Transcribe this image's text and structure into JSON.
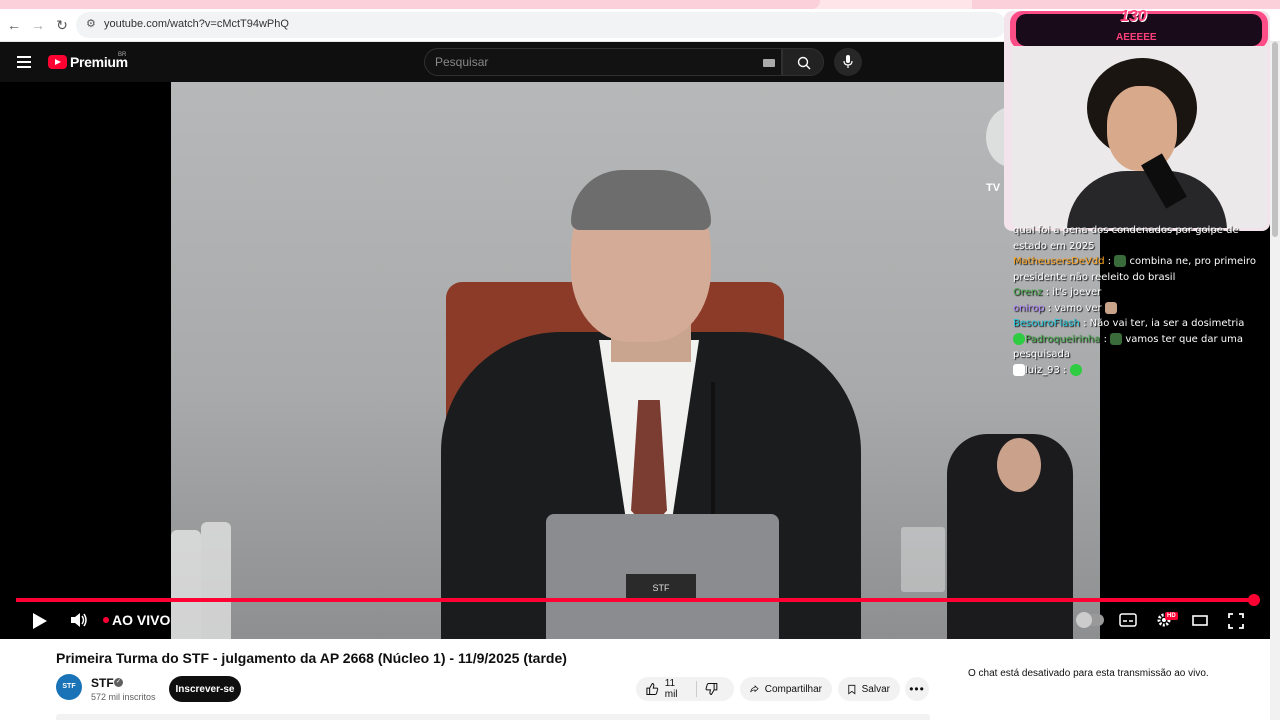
{
  "browser": {
    "url": "youtube.com/watch?v=cMctT94wPhQ"
  },
  "header": {
    "logo_text": "Premium",
    "logo_sup": "BR",
    "search_placeholder": "Pesquisar"
  },
  "player": {
    "live_label": "AO VIVO",
    "progress": 1.0,
    "tv_watermark": "TV",
    "laptop_label": "STF",
    "corner_mark": "🇧🇷🇧🇷🇧🇷"
  },
  "overlay": {
    "counter": "130",
    "counter_label": "AEEEEE"
  },
  "chat": {
    "messages": [
      {
        "user": "",
        "text": "qual foi a pena dos condenados por golpe de estado em 2025",
        "color": "#ffffff"
      },
      {
        "user": "MatheusersDeVdd",
        "text": "combina ne, pro primeiro presidente não reeleito do brasil",
        "color": "#ffa726"
      },
      {
        "user": "Orenz",
        "text": "it's joever",
        "color": "#4caf50"
      },
      {
        "user": "onirop",
        "text": "vamo ver",
        "color": "#b388ff"
      },
      {
        "user": "BesouroFlash",
        "text": "Não vai ter, ia ser a dosimetria",
        "color": "#26c6da"
      },
      {
        "user": "Padroqueirinha",
        "text": "vamos ter que dar uma pesquisada",
        "color": "#4caf50"
      },
      {
        "user": "luiz_93",
        "text": "",
        "color": "#ffffff"
      }
    ]
  },
  "video": {
    "title": "Primeira Turma do STF - julgamento da AP 2668 (Núcleo 1) - 11/9/2025 (tarde)",
    "channel_name": "STF",
    "channel_avatar_text": "STF",
    "subscribers": "572 mil inscritos",
    "subscribe_label": "Inscrever-se",
    "likes": "11 mil",
    "share_label": "Compartilhar",
    "save_label": "Salvar"
  },
  "chat_panel": {
    "disabled_text": "O chat está desativado para esta transmissão ao vivo."
  }
}
